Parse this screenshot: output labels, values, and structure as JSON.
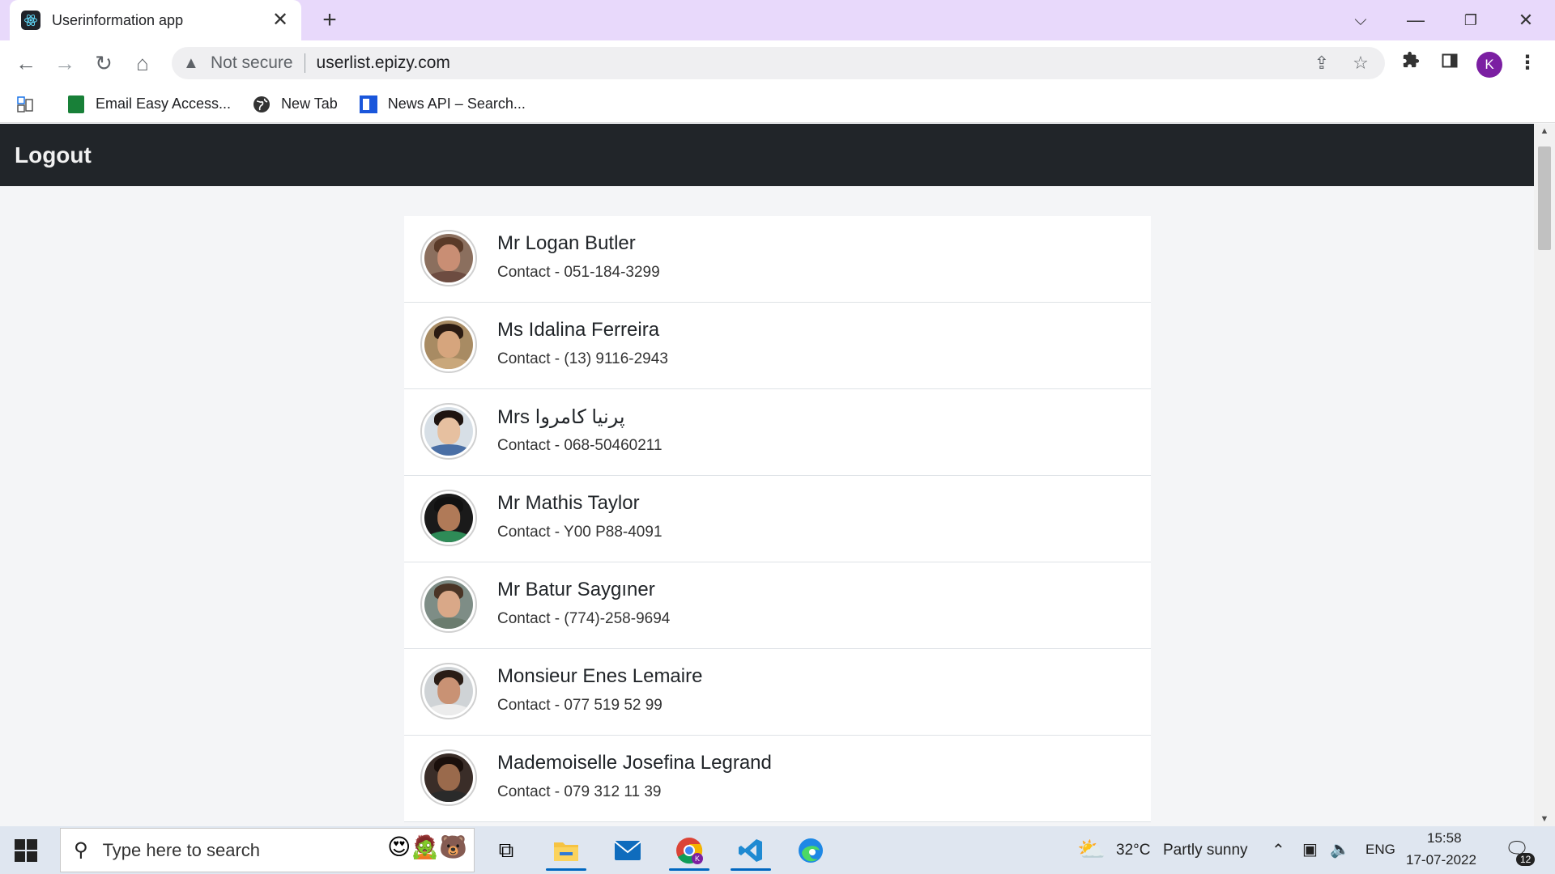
{
  "browser": {
    "tab_title": "Userinformation app",
    "tab_close": "✕",
    "new_tab": "+",
    "window_controls": {
      "dropdown": "⌵",
      "minimize": "—",
      "restore": "❐",
      "close": "✕"
    },
    "nav": {
      "back": "←",
      "forward": "→",
      "reload": "↻",
      "home": "⌂"
    },
    "address": {
      "security_label": "Not secure",
      "url": "userlist.epizy.com"
    },
    "profile_initial": "K",
    "bookmarks": [
      {
        "label": "Email Easy Access...",
        "icon": "spreadsheet-icon"
      },
      {
        "label": "New Tab",
        "icon": "globe-icon"
      },
      {
        "label": "News API – Search...",
        "icon": "news-api-icon"
      }
    ]
  },
  "app": {
    "header": {
      "logout_label": "Logout"
    },
    "users": [
      {
        "name": "Mr Logan Butler",
        "contact": "Contact - 051-184-3299",
        "skin": "#c98e74",
        "hair": "#5a3a28",
        "shirt": "#6d4c41",
        "bg": "#8b6f5e"
      },
      {
        "name": "Ms Idalina Ferreira",
        "contact": "Contact - (13) 9116-2943",
        "skin": "#d6a57d",
        "hair": "#2b1b12",
        "shirt": "#c9a77b",
        "bg": "#a88b63"
      },
      {
        "name": "Mrs پرنیا کامروا",
        "contact": "Contact - 068-50460211",
        "skin": "#e6c0a0",
        "hair": "#1e1410",
        "shirt": "#4a6fa5",
        "bg": "#d7dfe6"
      },
      {
        "name": "Mr Mathis Taylor",
        "contact": "Contact - Y00 P88-4091",
        "skin": "#b07a58",
        "hair": "#111111",
        "shirt": "#2e8b57",
        "bg": "#1a1a1a"
      },
      {
        "name": "Mr Batur Saygıner",
        "contact": "Contact - (774)-258-9694",
        "skin": "#d9a888",
        "hair": "#4a3526",
        "shirt": "#6b7c6e",
        "bg": "#7e8d86"
      },
      {
        "name": "Monsieur Enes Lemaire",
        "contact": "Contact - 077 519 52 99",
        "skin": "#c99274",
        "hair": "#2a1d16",
        "shirt": "#ececec",
        "bg": "#cfd3d6"
      },
      {
        "name": "Mademoiselle Josefina Legrand",
        "contact": "Contact - 079 312 11 39",
        "skin": "#9a6a4c",
        "hair": "#1a0f0b",
        "shirt": "#2a2a2a",
        "bg": "#3a2d28"
      }
    ]
  },
  "taskbar": {
    "search_placeholder": "Type here to search",
    "weather": {
      "temp": "32°C",
      "condition": "Partly sunny"
    },
    "language": "ENG",
    "time": "15:58",
    "date": "17-07-2022",
    "notification_count": "12"
  }
}
